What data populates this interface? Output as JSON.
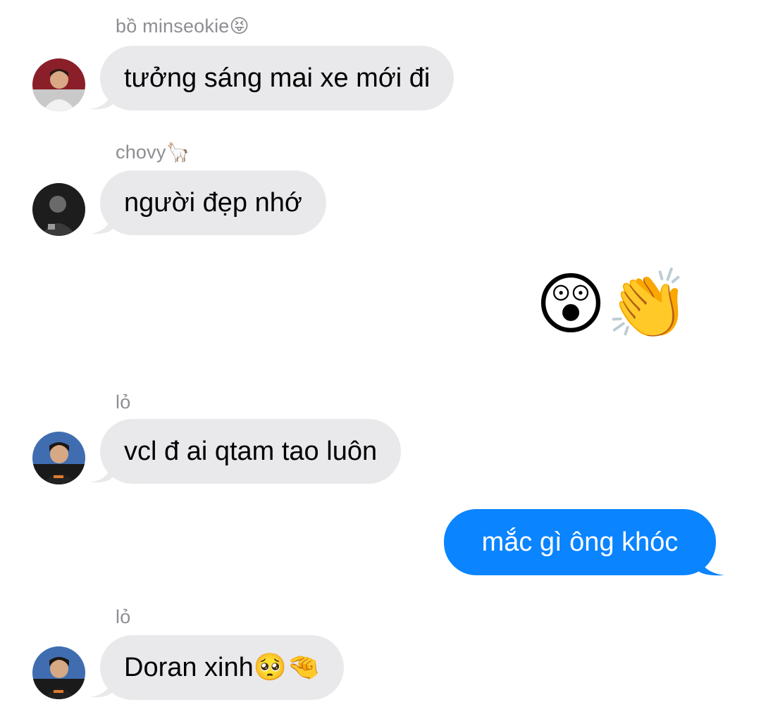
{
  "messages": [
    {
      "sender": "bồ minseokie",
      "sender_emoji": "😝",
      "text": "tưởng sáng mai xe mới đi"
    },
    {
      "sender": "chovy",
      "sender_emoji": "🦙",
      "text": "người đẹp nhớ"
    },
    {
      "outgoing_emojis": "😲👏"
    },
    {
      "sender": "lỏ",
      "text": "vcl đ ai qtam tao luôn"
    },
    {
      "outgoing_text": "mắc gì ông khóc"
    },
    {
      "sender": "lỏ",
      "text": "Doran xinh",
      "text_emoji": "🥺🤏"
    }
  ],
  "colors": {
    "incoming_bubble": "#e9e9eb",
    "outgoing_bubble": "#0a84ff",
    "sender_name": "#8e8e93"
  }
}
